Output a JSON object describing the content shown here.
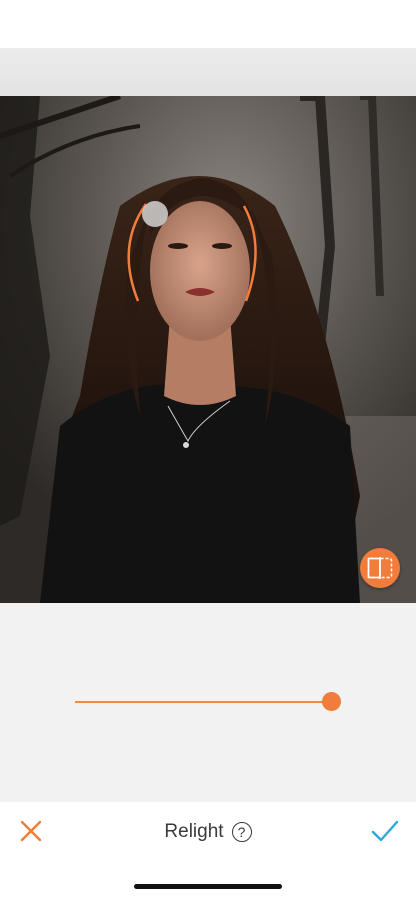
{
  "toolbar": {
    "title": "Relight",
    "help_symbol": "?",
    "cancel_icon": "close-icon",
    "confirm_icon": "checkmark-icon"
  },
  "slider": {
    "value_fraction": 1.0
  },
  "editor": {
    "compare_icon": "split-compare-icon",
    "light_handle_icon": "light-source-handle"
  },
  "colors": {
    "accent": "#f07d3b",
    "confirm": "#2aa9d8",
    "background": "#f2f2f2"
  }
}
